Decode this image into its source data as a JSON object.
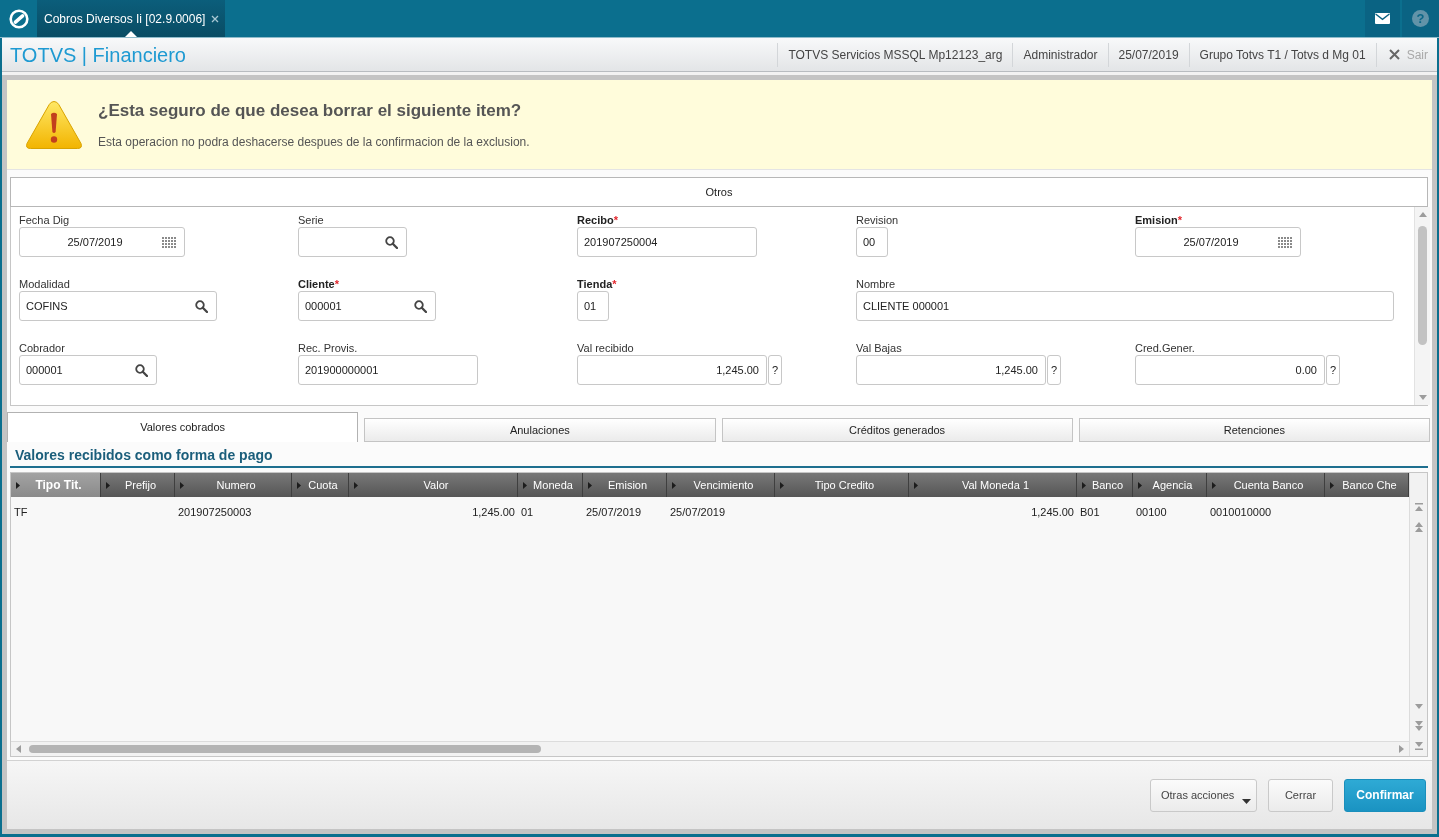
{
  "top_bar": {
    "tabs": [
      {
        "label": "Cobros Diversos Ii [02.9.0006]",
        "selected": true
      }
    ],
    "help": "?"
  },
  "header": {
    "title": "TOTVS | Financiero",
    "info": [
      "TOTVS Servicios MSSQL Mp12123_arg",
      "Administrador",
      "25/07/2019",
      "Grupo Totvs T1 / Totvs d Mg 01"
    ],
    "exit": {
      "label": "Sair",
      "disabled": true
    }
  },
  "warning": {
    "title": "¿Esta seguro de que desea borrar el siguiente item?",
    "message": "Esta operacion no podra deshacerse despues de la confirmacion de la exclusion."
  },
  "form": {
    "title": "Otros",
    "rows": [
      [
        {
          "label": "Fecha Dig",
          "required": false,
          "kind": "date",
          "value": "25/07/2019"
        },
        {
          "label": "Serie",
          "required": false,
          "kind": "lookup"
        },
        {
          "label": "Recibo",
          "required": true,
          "marker": "*",
          "kind": "text",
          "value": "201907250004"
        },
        {
          "label": "Revision",
          "required": false,
          "kind": "text",
          "value": "00"
        },
        {
          "label": "Emision",
          "required": true,
          "marker": "*",
          "kind": "date",
          "value": "25/07/2019"
        }
      ],
      [
        {
          "label": "Modalidad",
          "required": false,
          "kind": "lookup",
          "value": "COFINS"
        },
        {
          "label": "Cliente",
          "required": true,
          "marker": "*",
          "kind": "lookup",
          "value": "000001"
        },
        {
          "label": "Tienda",
          "required": true,
          "marker": "*",
          "kind": "text",
          "value": "01"
        },
        {
          "label": "Nombre",
          "required": false,
          "kind": "text",
          "value": "CLIENTE 000001"
        }
      ],
      [
        {
          "label": "Cobrador",
          "required": false,
          "kind": "lookup",
          "value": "000001"
        },
        {
          "label": "Rec. Provis.",
          "required": false,
          "kind": "text",
          "value": "201900000001"
        },
        {
          "label": "Val recibido",
          "required": false,
          "kind": "number",
          "value": "1,245.00",
          "help": "?"
        },
        {
          "label": "Val Bajas",
          "required": false,
          "kind": "number",
          "value": "1,245.00",
          "help": "?"
        },
        {
          "label": "Cred.Gener.",
          "required": false,
          "kind": "number",
          "value": "0.00",
          "help": "?"
        }
      ]
    ]
  },
  "tabs": [
    {
      "label": "Valores cobrados",
      "selected": true
    },
    {
      "label": "Anulaciones",
      "selected": false
    },
    {
      "label": "Créditos generados",
      "selected": false
    },
    {
      "label": "Retenciones",
      "selected": false
    }
  ],
  "grid": {
    "title": "Valores recibidos como forma de pago",
    "columns": [
      {
        "label": "Tipo Tit.",
        "selected": true,
        "kind": "text"
      },
      {
        "label": "Prefijo",
        "selected": false,
        "kind": "text"
      },
      {
        "label": "Numero",
        "selected": false,
        "kind": "text"
      },
      {
        "label": "Cuota",
        "selected": false,
        "kind": "text"
      },
      {
        "label": "Valor",
        "selected": false,
        "kind": "number"
      },
      {
        "label": "Moneda",
        "selected": false,
        "kind": "text"
      },
      {
        "label": "Emision",
        "selected": false,
        "kind": "text"
      },
      {
        "label": "Vencimiento",
        "selected": false,
        "kind": "text"
      },
      {
        "label": "Tipo Credito",
        "selected": false,
        "kind": "text"
      },
      {
        "label": "Val Moneda 1",
        "selected": false,
        "kind": "number"
      },
      {
        "label": "Banco",
        "selected": false,
        "kind": "text"
      },
      {
        "label": "Agencia",
        "selected": false,
        "kind": "text"
      },
      {
        "label": "Cuenta Banco",
        "selected": false,
        "kind": "text"
      },
      {
        "label": "Banco Che",
        "selected": false,
        "kind": "text"
      }
    ],
    "rows": [
      {
        "cells": [
          "TF",
          null,
          "201907250003",
          null,
          "1,245.00",
          "01",
          "25/07/2019",
          "25/07/2019",
          null,
          "1,245.00",
          "B01",
          "00100",
          "0010010000",
          null
        ]
      }
    ]
  },
  "buttons": [
    {
      "label": "Otras acciones",
      "kind": "menu"
    },
    {
      "label": "Cerrar",
      "kind": "secondary"
    },
    {
      "label": "Confirmar",
      "kind": "primary"
    }
  ]
}
